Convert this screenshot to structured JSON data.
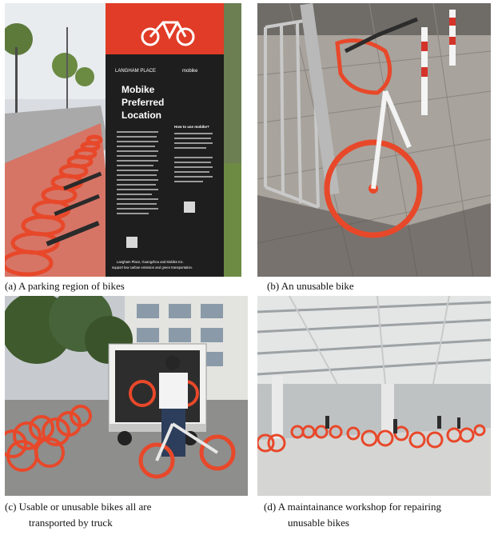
{
  "figure": {
    "panels": [
      {
        "caption": "(a)  A parking region of bikes",
        "sign": {
          "header_left": "LANGHAM PLACE",
          "header_right": "mobike",
          "title_line1": "Mobike",
          "title_line2": "Preferred",
          "title_line3": "Location",
          "how_to": "How to use mobike?",
          "footer_line1": "Langham Place, Guangzhou and Mobike Inc.",
          "footer_line2": "support low carbon emission and green transportation."
        }
      },
      {
        "caption": "(b) An unusable bike"
      },
      {
        "caption_line1": "(c)  Usable or unusable bikes all are",
        "caption_line2": "transported by truck"
      },
      {
        "caption_line1": "(d) A maintainance workshop for repairing",
        "caption_line2": "unusable bikes"
      }
    ]
  },
  "colors": {
    "mobike_orange": "#e8482a",
    "sign_dark": "#1e1e1e",
    "sign_red": "#e03c27"
  }
}
